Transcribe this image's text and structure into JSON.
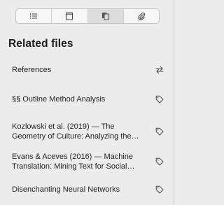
{
  "tabs": [
    {
      "name": "outline",
      "icon": "list-icon"
    },
    {
      "name": "page",
      "icon": "page-icon"
    },
    {
      "name": "related-files",
      "icon": "files-icon",
      "active": true
    },
    {
      "name": "attachments",
      "icon": "paperclip-icon"
    }
  ],
  "panel": {
    "title": "Related files"
  },
  "items": [
    {
      "label": "References",
      "icon": "swap-arrows-icon"
    },
    {
      "label": "§§ Outline Method Analysis",
      "icon": "tag-icon"
    },
    {
      "label": "Kozlowski et al. (2019) — The\nGeometry of Culture: Analyzing the…",
      "icon": "tag-icon"
    },
    {
      "label": "Evans & Aceves (2016) — Machine\nTranslation: Mining Text for Social…",
      "icon": "tag-icon"
    },
    {
      "label": "Disenchanting Neural Networks",
      "icon": "tag-icon"
    }
  ]
}
